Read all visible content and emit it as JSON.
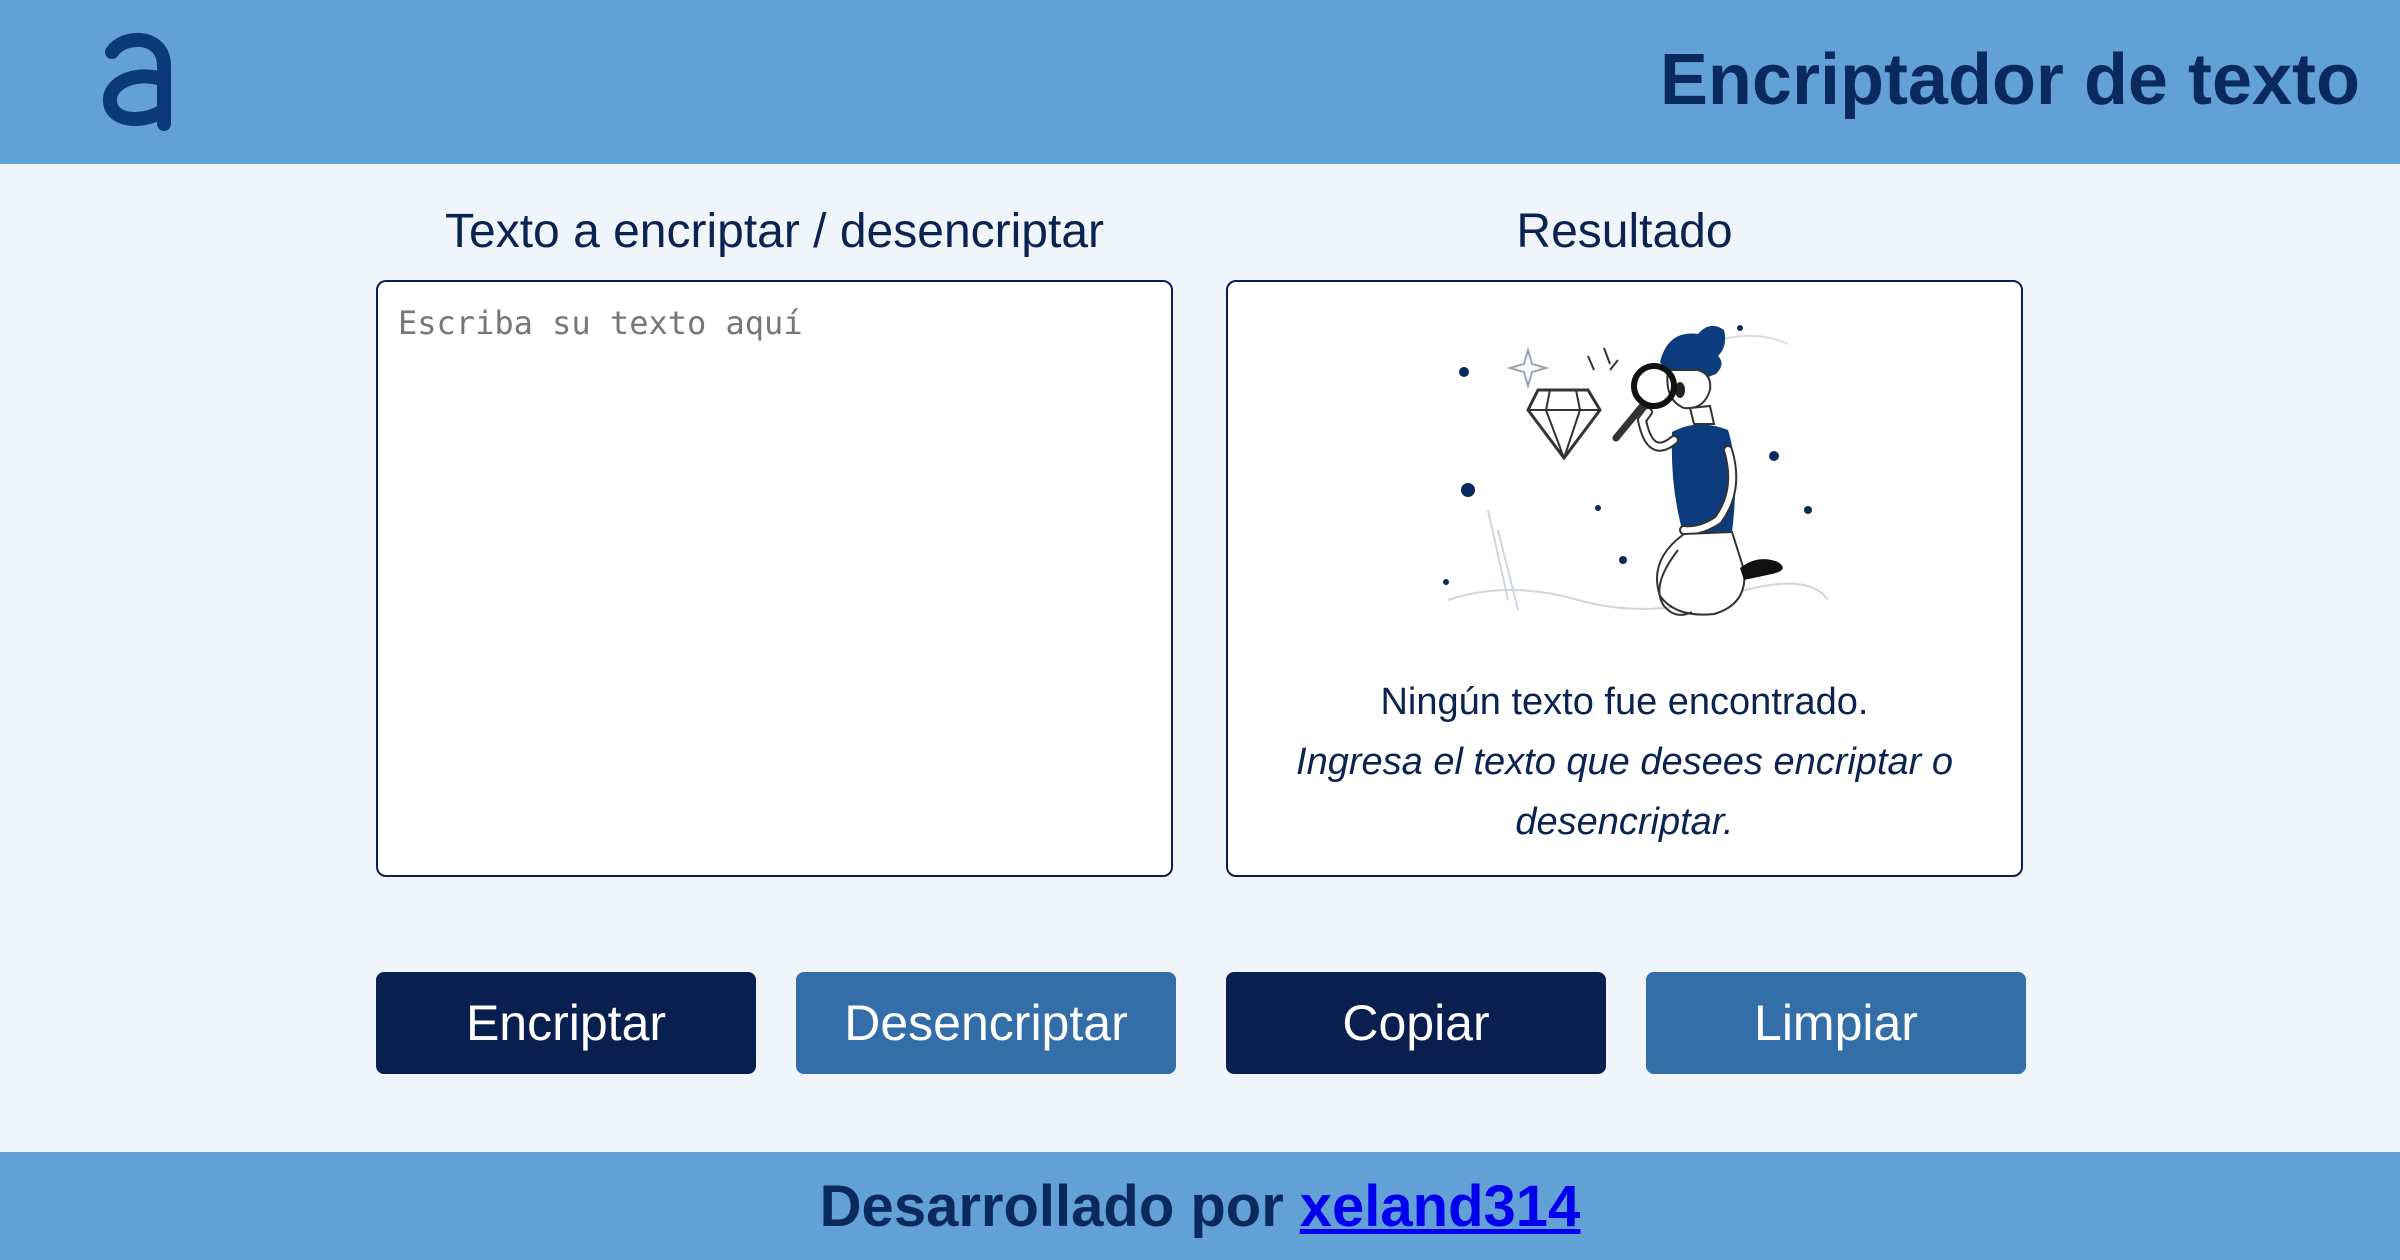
{
  "header": {
    "logo_icon": "alura-a-logo",
    "title": "Encriptador de texto"
  },
  "input_panel": {
    "title": "Texto a encriptar / desencriptar",
    "placeholder": "Escriba su texto aquí"
  },
  "output_panel": {
    "title": "Resultado",
    "illustration": "person-with-magnifying-glass-and-diamond",
    "empty_title": "Ningún texto fue encontrado.",
    "empty_subtitle_line1": "Ingresa el texto que desees encriptar o",
    "empty_subtitle_line2": "desencriptar."
  },
  "buttons": {
    "encrypt": "Encriptar",
    "decrypt": "Desencriptar",
    "copy": "Copiar",
    "clear": "Limpiar"
  },
  "footer": {
    "prefix": "Desarrollado por",
    "author": "xeland314"
  },
  "colors": {
    "header_bg": "#62a0d6",
    "page_bg": "#f0f4fb",
    "primary_dark": "#081f50",
    "primary_light": "#336ea8",
    "text": "#0a2350"
  }
}
